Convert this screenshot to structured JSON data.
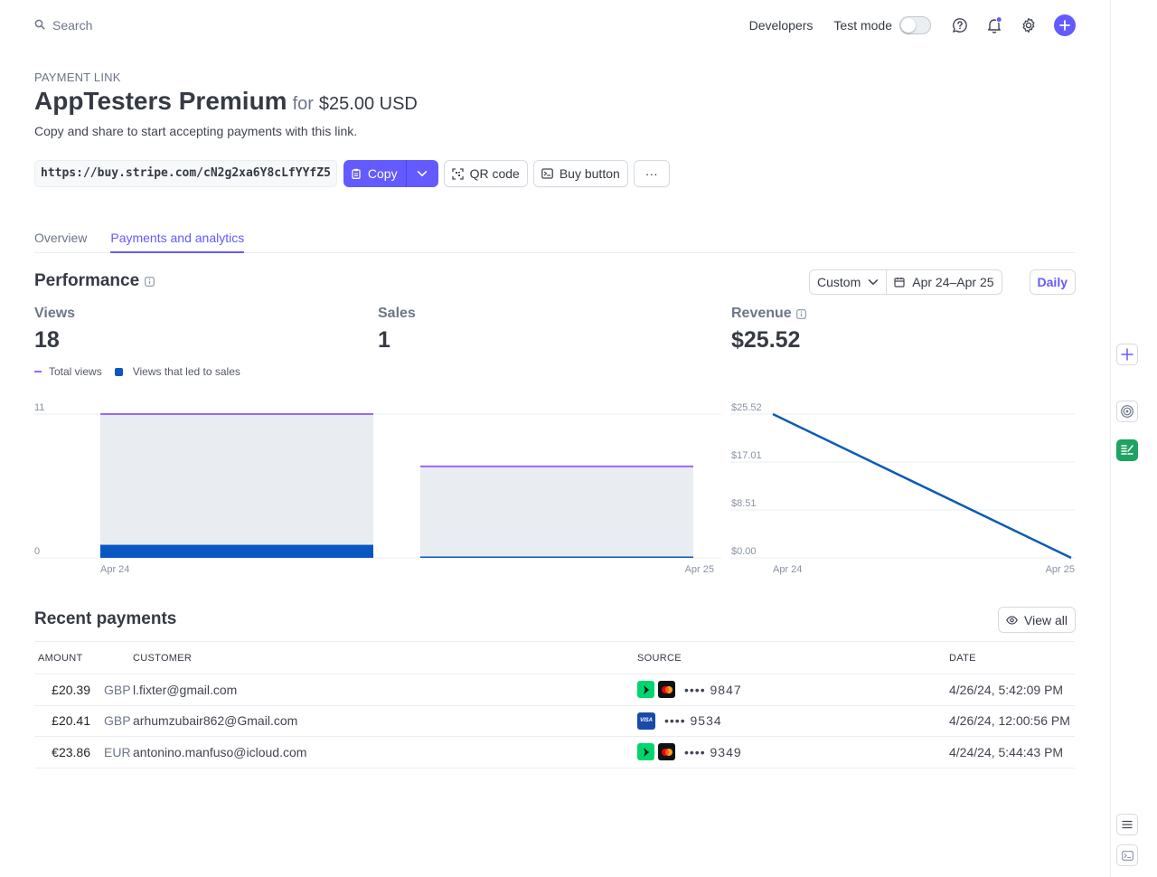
{
  "topbar": {
    "search_placeholder": "Search",
    "developers": "Developers",
    "test_mode": "Test mode"
  },
  "header": {
    "eyebrow": "PAYMENT LINK",
    "name": "AppTesters Premium",
    "for": "for",
    "price": "$25.00 USD",
    "description": "Copy and share to start accepting payments with this link."
  },
  "link": {
    "url": "https://buy.stripe.com/cN2g2xa6Y8cLfYYfZ5",
    "copy": "Copy",
    "qr": "QR code",
    "buy_button": "Buy button",
    "more": "···"
  },
  "tabs": [
    {
      "label": "Overview"
    },
    {
      "label": "Payments and analytics"
    }
  ],
  "performance": {
    "title": "Performance",
    "range_preset": "Custom",
    "range": "Apr 24–Apr 25",
    "interval": "Daily",
    "metrics": [
      {
        "label": "Views",
        "value": "18"
      },
      {
        "label": "Sales",
        "value": "1"
      },
      {
        "label": "Revenue",
        "value": "$25.52"
      }
    ],
    "legend": [
      "Total views",
      "Views that led to sales"
    ]
  },
  "chart_data": [
    {
      "type": "bar",
      "categories": [
        "Apr 24",
        "Apr 25"
      ],
      "series": [
        {
          "name": "Total views",
          "values": [
            11,
            7
          ]
        },
        {
          "name": "Views that led to sales",
          "values": [
            1,
            0
          ]
        }
      ],
      "ylim": [
        0,
        11
      ],
      "ytick_labels": [
        "0",
        "11"
      ],
      "xtick_labels": [
        "Apr 24",
        "Apr 25"
      ]
    },
    {
      "type": "line",
      "x": [
        "Apr 24",
        "Apr 25"
      ],
      "series": [
        {
          "name": "Revenue",
          "values": [
            25.52,
            0
          ]
        }
      ],
      "ylim": [
        0,
        25.52
      ],
      "ytick_labels": [
        "$0.00",
        "$8.51",
        "$17.01",
        "$25.52"
      ],
      "xtick_labels": [
        "Apr 24",
        "Apr 25"
      ]
    }
  ],
  "recent_payments": {
    "title": "Recent payments",
    "view_all": "View all",
    "columns": [
      "AMOUNT",
      "CUSTOMER",
      "SOURCE",
      "DATE"
    ],
    "rows": [
      {
        "amount": "£20.39",
        "currency": "GBP",
        "customer": "l.fixter@gmail.com",
        "brand": "mastercard-link",
        "last4": "•••• 9847",
        "date": "4/26/24, 5:42:09 PM"
      },
      {
        "amount": "£20.41",
        "currency": "GBP",
        "customer": "arhumzubair862@Gmail.com",
        "brand": "visa",
        "last4": "•••• 9534",
        "date": "4/26/24, 12:00:56 PM"
      },
      {
        "amount": "€23.86",
        "currency": "EUR",
        "customer": "antonino.manfuso@icloud.com",
        "brand": "mastercard-link",
        "last4": "•••• 9349",
        "date": "4/24/24, 5:44:43 PM"
      }
    ]
  },
  "colors": {
    "accent": "#635bff",
    "views_line": "#9966ff",
    "sales_bar": "#0a56c2",
    "bar_fill": "#e9edf1",
    "revenue_line": "#0d5bb5"
  }
}
